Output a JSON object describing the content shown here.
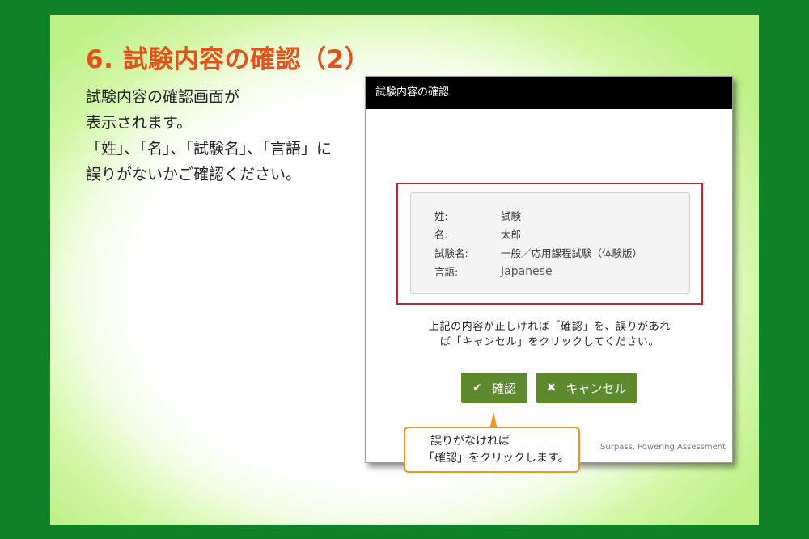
{
  "slide": {
    "title": "6.  試験内容の確認（2）",
    "text_lines": [
      "試験内容の確認画面が",
      "表示されます。",
      "「姓」、「名」、「試験名」、「言語」に",
      "誤りがないかご確認ください。"
    ]
  },
  "dialog": {
    "title": "試験内容の確認",
    "info": [
      {
        "label": "姓:",
        "value": "試験"
      },
      {
        "label": "名:",
        "value": "太郎"
      },
      {
        "label": "試験名:",
        "value": "一般／応用課程試験（体験版）"
      },
      {
        "label": "言語:",
        "value": "Japanese"
      }
    ],
    "instruction_lines": [
      "上記の内容が正しければ「確認」を、誤りがあれ",
      "ば「キャンセル」をクリックしてください。"
    ],
    "confirm_label": "確認",
    "cancel_label": "キャンセル",
    "footer": "Surpass, Powering Assessment"
  },
  "callout": {
    "lines": [
      "誤りがなければ",
      "「確認」をクリックします。"
    ]
  },
  "colors": {
    "background": "#0f8227",
    "title": "#e8501a",
    "highlight_border": "#c8232c",
    "button": "#5c8a2d",
    "callout_border": "#f0961e"
  },
  "icons": {
    "confirm": "check-icon",
    "cancel": "close-icon"
  }
}
